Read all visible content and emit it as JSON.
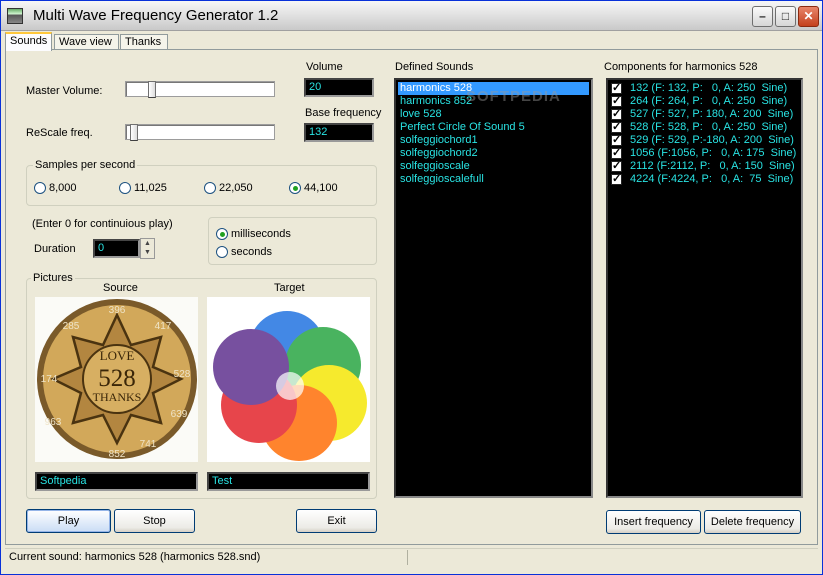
{
  "window": {
    "title": "Multi Wave Frequency Generator 1.2",
    "minimize": "–",
    "maximize": "□",
    "close": "✕"
  },
  "tabs": [
    {
      "label": "Sounds"
    },
    {
      "label": "Wave view"
    },
    {
      "label": "Thanks"
    }
  ],
  "controls": {
    "master_volume_label": "Master Volume:",
    "master_volume_level": 0.16,
    "rescale_label": "ReScale freq.",
    "rescale_level": 0.03,
    "volume_label": "Volume",
    "volume_value": "20",
    "base_freq_label": "Base frequency",
    "base_freq_value": "132"
  },
  "samples": {
    "title": "Samples per second",
    "options": [
      {
        "label": "8,000",
        "selected": false
      },
      {
        "label": "11,025",
        "selected": false
      },
      {
        "label": "22,050",
        "selected": false
      },
      {
        "label": "44,100",
        "selected": true
      }
    ]
  },
  "duration": {
    "hint": "(Enter 0 for continuious play)",
    "label": "Duration",
    "value": "0",
    "units": [
      {
        "label": "milliseconds",
        "selected": true
      },
      {
        "label": "seconds",
        "selected": false
      }
    ]
  },
  "pictures": {
    "title": "Pictures",
    "source_label": "Source",
    "target_label": "Target",
    "source_name": "Softpedia",
    "target_name": "Test",
    "seal": {
      "top": "396",
      "right_top": "417",
      "right": "528",
      "right_bottom": "639",
      "bottom_right": "741",
      "bottom": "852",
      "left_bottom": "963",
      "left": "174",
      "left_top": "285",
      "line1": "LOVE",
      "line2": "528",
      "line3": "THANKS"
    }
  },
  "defined_sounds": {
    "title": "Defined Sounds",
    "items": [
      "harmonics 528",
      "harmonics 852",
      "love 528",
      "Perfect Circle Of Sound 5",
      "solfeggiochord1",
      "solfeggiochord2",
      "solfeggioscale",
      "solfeggioscalefull"
    ],
    "selected_index": 0
  },
  "components": {
    "title": "Components for harmonics 528",
    "items": [
      "132 (F: 132, P:   0, A: 250  Sine)",
      "264 (F: 264, P:   0, A: 250  Sine)",
      "527 (F: 527, P: 180, A: 200  Sine)",
      "528 (F: 528, P:   0, A: 250  Sine)",
      "529 (F: 529, P:-180, A: 200  Sine)",
      "1056 (F:1056, P:   0, A: 175  Sine)",
      "2112 (F:2112, P:   0, A: 150  Sine)",
      "4224 (F:4224, P:   0, A:  75  Sine)"
    ]
  },
  "buttons": {
    "play": "Play",
    "stop": "Stop",
    "exit": "Exit",
    "insert": "Insert frequency",
    "delete": "Delete frequency"
  },
  "status": {
    "text": "Current sound: harmonics 528 (harmonics 528.snd)"
  },
  "watermark": "SOFTPEDIA"
}
